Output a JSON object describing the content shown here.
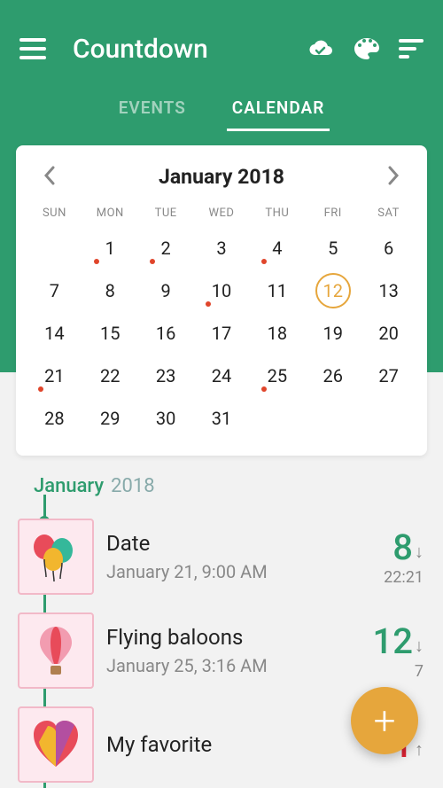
{
  "app": {
    "title": "Countdown"
  },
  "tabs": [
    {
      "label": "EVENTS",
      "active": false
    },
    {
      "label": "CALENDAR",
      "active": true
    }
  ],
  "calendar": {
    "month_label": "January 2018",
    "dows": [
      "SUN",
      "MON",
      "TUE",
      "WED",
      "THU",
      "FRI",
      "SAT"
    ],
    "first_dow_offset": 1,
    "days_in_month": 31,
    "today": 12,
    "dotted": [
      1,
      2,
      4,
      10,
      21,
      25
    ]
  },
  "list_header": {
    "month": "January",
    "year": "2018"
  },
  "events": [
    {
      "title": "Date",
      "subtitle": "January 21, 9:00 AM",
      "count": "8",
      "dir": "↓",
      "time": "22:21",
      "icon": "balloons",
      "count_color": "green"
    },
    {
      "title": "Flying baloons",
      "subtitle": "January 25, 3:16 AM",
      "count": "12",
      "dir": "↓",
      "time": "7",
      "icon": "hotair",
      "count_color": "green"
    },
    {
      "title": "My favorite",
      "subtitle": "",
      "count": "1",
      "dir": "↑",
      "time": "",
      "icon": "heart",
      "count_color": "red"
    }
  ],
  "fab": {
    "label": "+"
  }
}
